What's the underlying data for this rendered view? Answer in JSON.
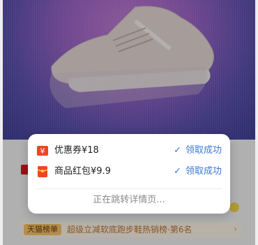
{
  "popup": {
    "coupons": [
      {
        "icon": "yuan-coupon-icon",
        "label": "优惠券¥18",
        "status": "领取成功"
      },
      {
        "icon": "red-envelope-icon",
        "label": "商品红包¥9.9",
        "status": "领取成功"
      }
    ],
    "redirect_text": "正在跳转详情页..."
  },
  "background": {
    "rank_tag": "天猫榜单",
    "rank_text": "超级立减软底跑步鞋热销榜·第6名"
  },
  "colors": {
    "accent_blue": "#3b78d6",
    "tmall_red": "#e0141e"
  }
}
